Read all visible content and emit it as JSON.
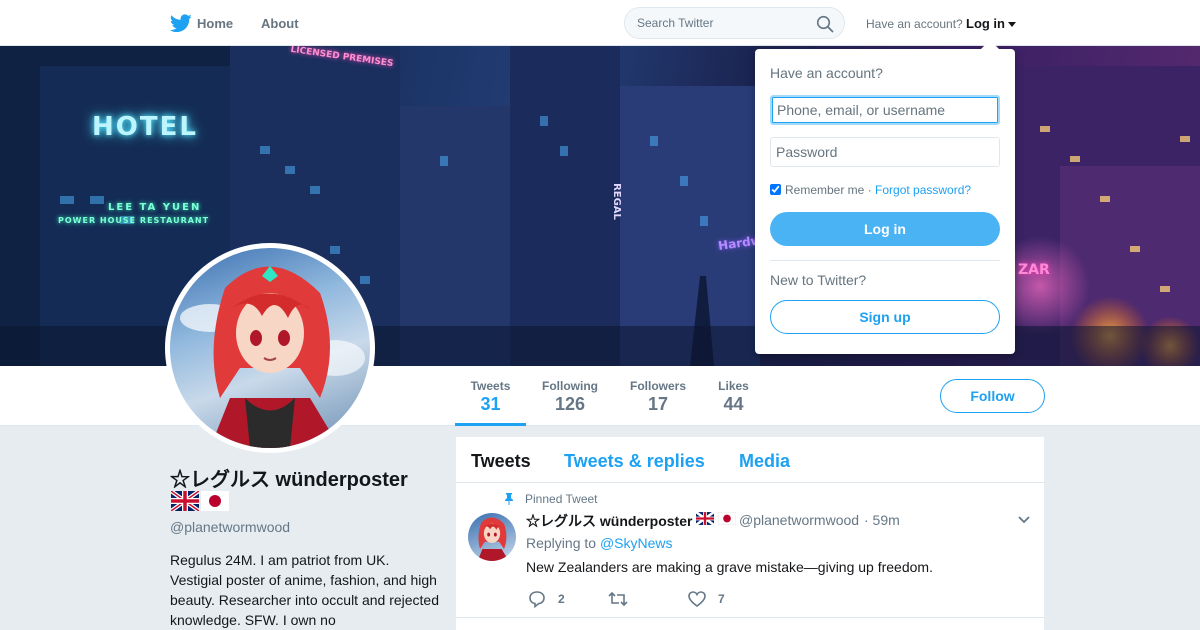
{
  "nav": {
    "home_label": "Home",
    "about_label": "About",
    "search_placeholder": "Search Twitter",
    "have_account": "Have an account?",
    "login_label": "Log in"
  },
  "banner": {
    "signs": [
      "HOTEL",
      "LEE TA YUEN",
      "POWER HOUSE RESTAURANT",
      "LICENSED PREMISES",
      "REGAL",
      "Hardw",
      "ZAR"
    ]
  },
  "profile": {
    "name": "☆レグルス wünderposter",
    "handle": "@planetwormwood",
    "bio": "Regulus 24M. I am patriot from UK. Vestigial poster of anime, fashion, and high beauty. Researcher into occult and rejected knowledge. SFW. I own no",
    "stats": [
      {
        "label": "Tweets",
        "value": "31"
      },
      {
        "label": "Following",
        "value": "126"
      },
      {
        "label": "Followers",
        "value": "17"
      },
      {
        "label": "Likes",
        "value": "44"
      }
    ],
    "follow_label": "Follow"
  },
  "timeline": {
    "tabs": [
      "Tweets",
      "Tweets & replies",
      "Media"
    ],
    "tweet": {
      "pinned_label": "Pinned Tweet",
      "name": "☆レグルス wünderposter",
      "handle": "@planetwormwood",
      "time": "· 59m",
      "replying_prefix": "Replying to",
      "replying_to": "@SkyNews",
      "text": "New Zealanders are making a grave mistake—giving up freedom.",
      "replies": "2",
      "retweets": "",
      "likes": "7"
    }
  },
  "login_dropdown": {
    "title": "Have an account?",
    "username_placeholder": "Phone, email, or username",
    "password_placeholder": "Password",
    "remember_label": "Remember me ·",
    "forgot_label": "Forgot password?",
    "login_button": "Log in",
    "new_prompt": "New to Twitter?",
    "signup_button": "Sign up"
  },
  "colors": {
    "accent": "#1da1f2",
    "login_button": "#4ab3f4",
    "muted": "#657786",
    "background": "#e6ecf0"
  }
}
